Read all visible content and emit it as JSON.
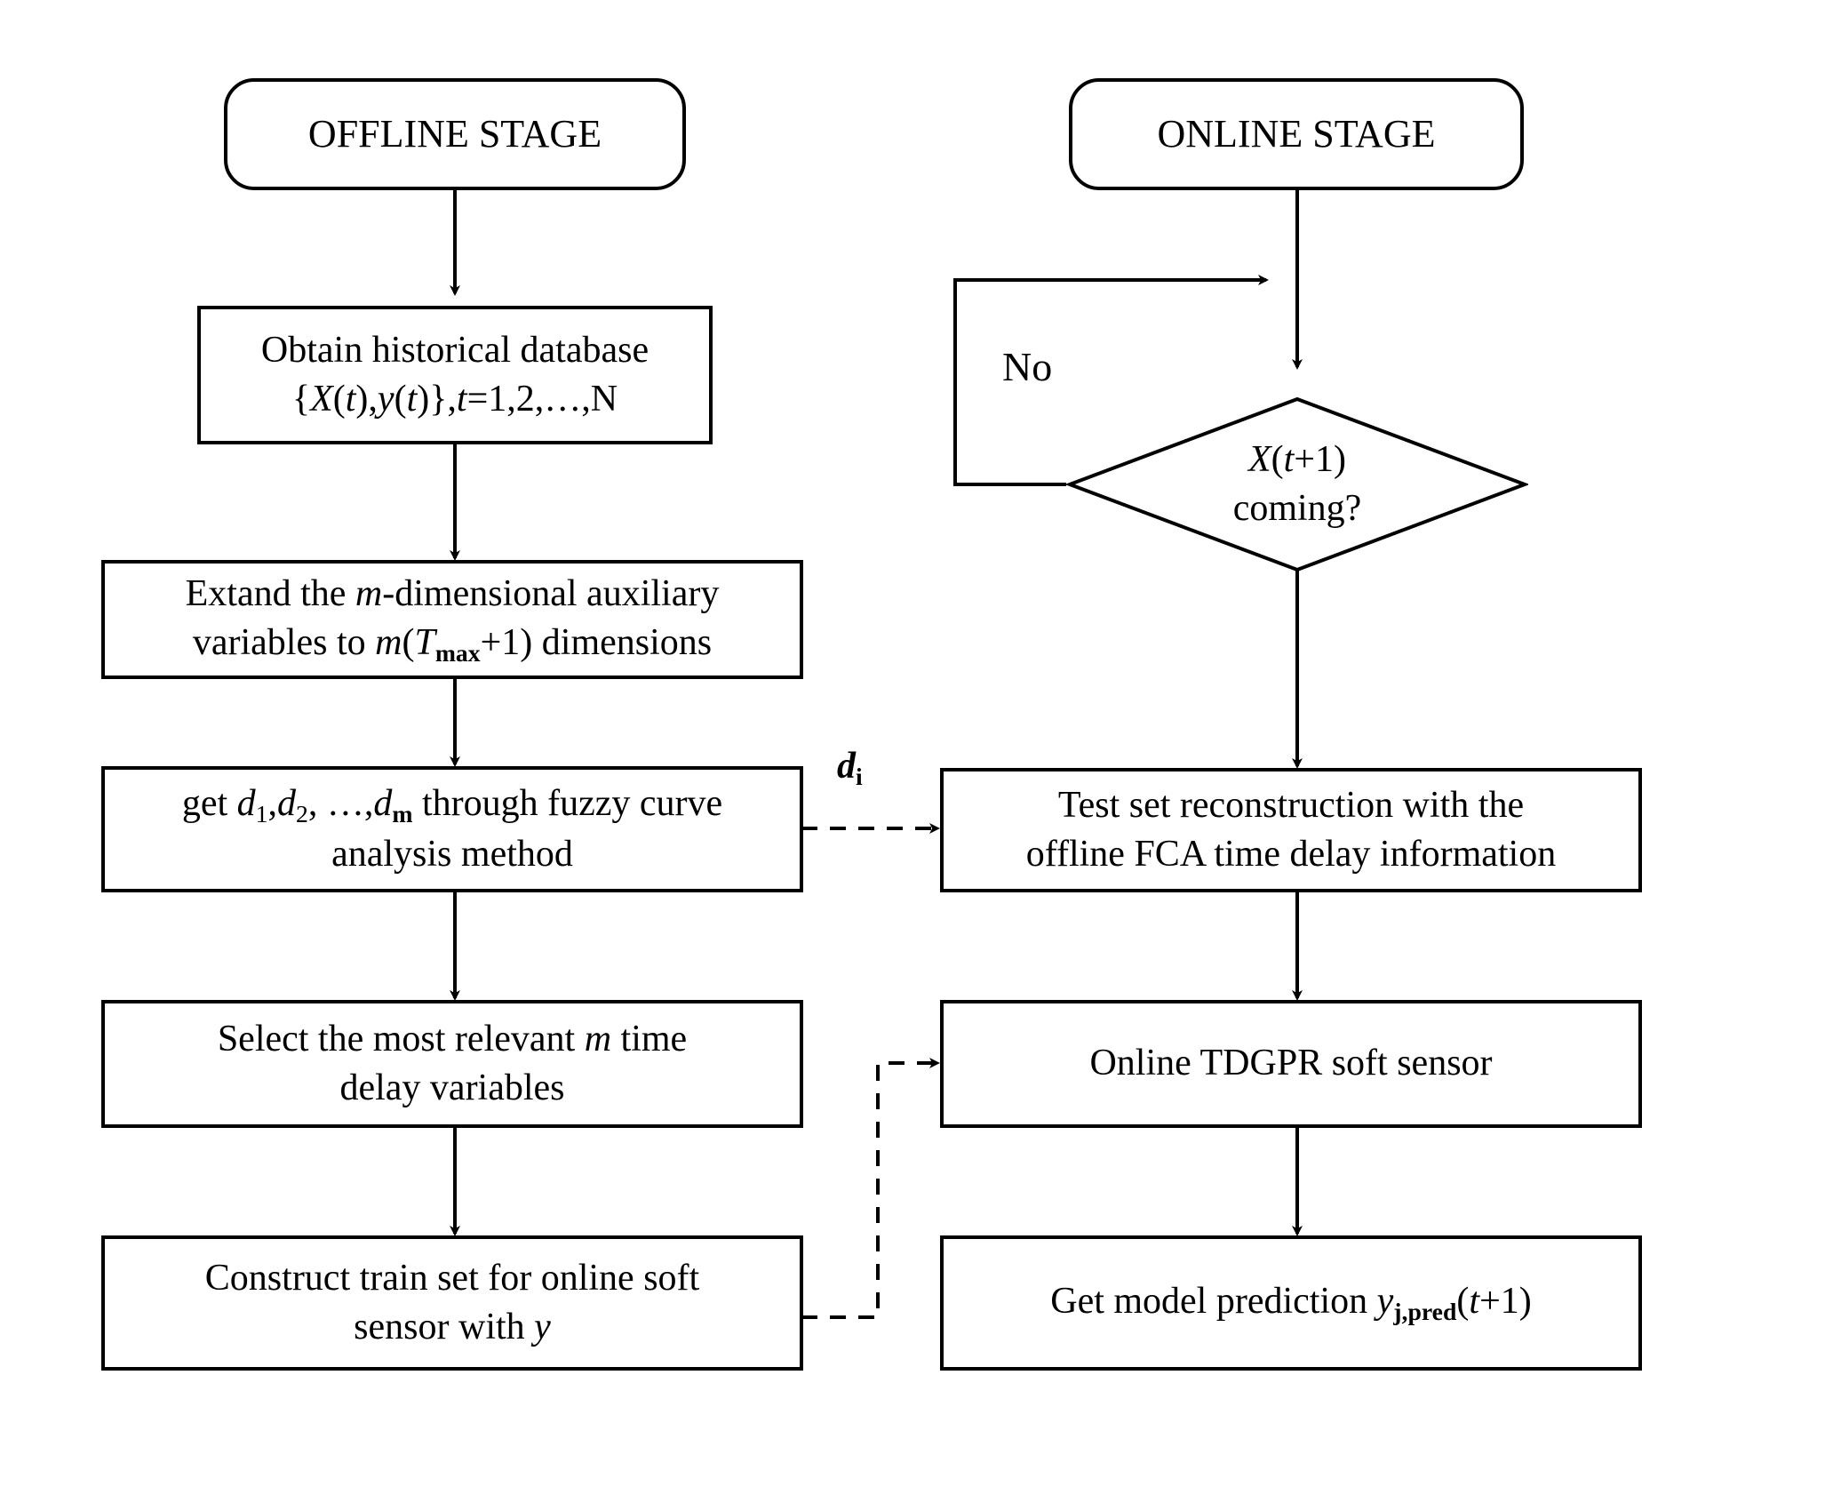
{
  "diagram": {
    "title_offline": "OFFLINE STAGE",
    "title_online": "ONLINE STAGE",
    "colors": {
      "stroke": "#000000",
      "background": "#ffffff",
      "text": "#000000"
    }
  },
  "offline": {
    "stage_label": "OFFLINE STAGE",
    "steps": [
      {
        "id": "obtain-historical-database",
        "line1": "Obtain historical database",
        "line2": "{X(t),y(t)},t=1,2,…,N",
        "plain": "Obtain historical database {X(t),y(t)},t=1,2,…,N"
      },
      {
        "id": "extand-dimensions",
        "line1": "Extand the m-dimensional auxiliary",
        "line2": "variables to m(Tmax+1) dimensions",
        "plain": "Extand the m-dimensional auxiliary variables to m(Tmax+1) dimensions"
      },
      {
        "id": "fuzzy-curve-analysis",
        "line1": "get d1,d2, …,dm through fuzzy curve",
        "line2": "analysis method",
        "plain": "get d1,d2, …,dm through fuzzy curve analysis method"
      },
      {
        "id": "select-relevant-time-delay",
        "line1": "Select the most relevant m time",
        "line2": "delay variables",
        "plain": "Select the most relevant m time delay variables"
      },
      {
        "id": "construct-train-set",
        "line1": "Construct train set for online soft",
        "line2": "sensor with y",
        "plain": "Construct train set for online soft sensor with y"
      }
    ]
  },
  "online": {
    "stage_label": "ONLINE STAGE",
    "decision": {
      "id": "x-t-plus-1-coming",
      "line1": "X(t+1)",
      "line2": "coming?",
      "plain": "X(t+1) coming?"
    },
    "no_branch_label": "No",
    "steps": [
      {
        "id": "test-set-reconstruction",
        "line1": "Test set reconstruction with the",
        "line2": "offline FCA time delay information",
        "plain": "Test set reconstruction with the offline FCA time delay information"
      },
      {
        "id": "online-tdgpr-soft-sensor",
        "line1": "Online TDGPR soft sensor",
        "line2": "",
        "plain": "Online TDGPR soft sensor"
      },
      {
        "id": "get-model-prediction",
        "line1": "Get model prediction yj,pred(t+1)",
        "line2": "",
        "plain": "Get model prediction yj,pred(t+1)"
      }
    ]
  },
  "connectors": {
    "fca_to_test_set_label": "di",
    "no_loop_label": "No"
  }
}
